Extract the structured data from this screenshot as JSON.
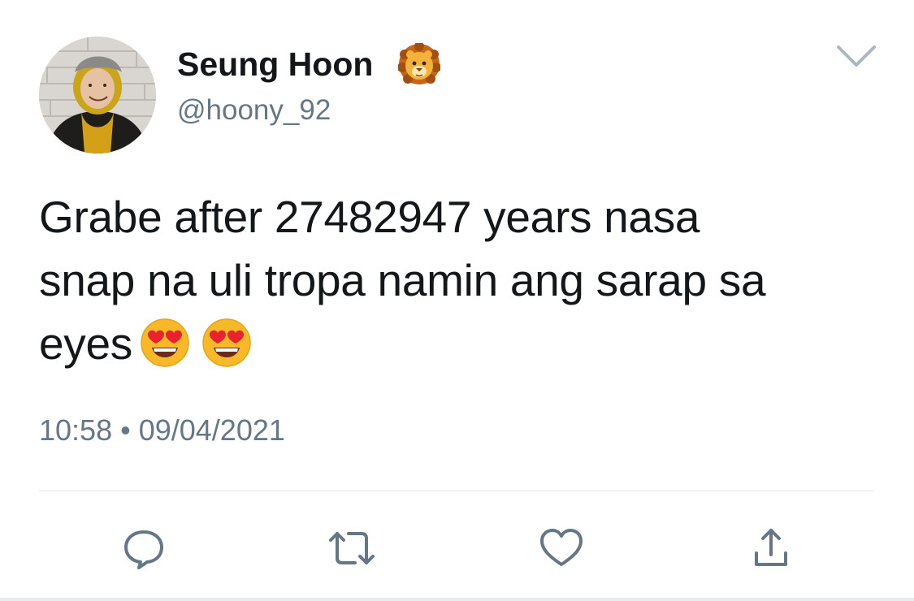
{
  "author": {
    "display_name": "Seung Hoon",
    "name_emoji": "lion-face-emoji",
    "handle": "@hoony_92",
    "avatar": "profile-photo"
  },
  "tweet": {
    "lines": [
      "Grabe after 27482947 years nasa",
      "snap na uli tropa namin ang sarap sa",
      "eyes"
    ],
    "trailing_emojis": [
      "heart-eyes-emoji",
      "heart-eyes-emoji"
    ]
  },
  "meta": {
    "time": "10:58",
    "separator": "•",
    "date": "09/04/2021"
  },
  "actions": [
    {
      "name": "reply-icon"
    },
    {
      "name": "retweet-icon"
    },
    {
      "name": "like-icon"
    },
    {
      "name": "share-icon"
    }
  ],
  "colors": {
    "primary_text": "#14171a",
    "secondary_text": "#657786",
    "icon_gray": "#657786",
    "divider": "#e1e8ed"
  }
}
